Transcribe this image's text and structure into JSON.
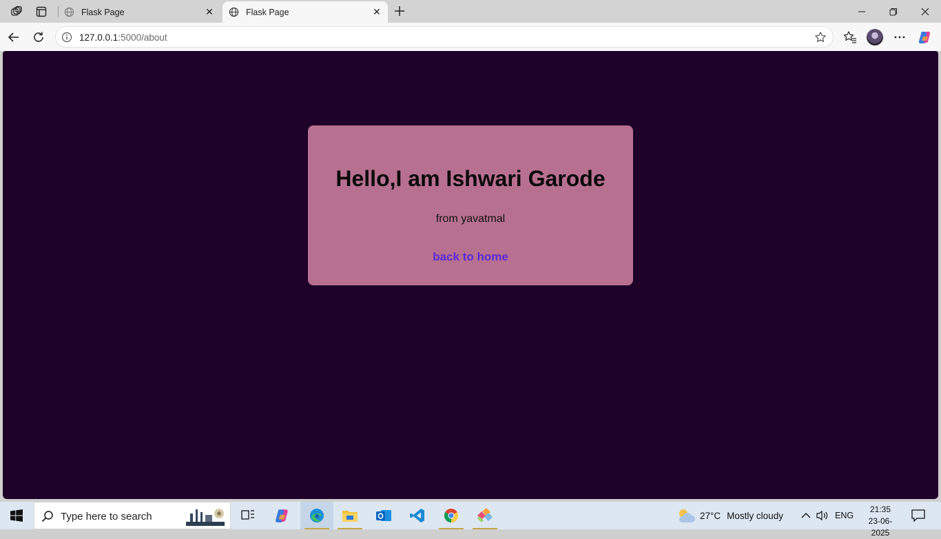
{
  "browser": {
    "tabs": [
      {
        "label": "Flask Page",
        "active": false
      },
      {
        "label": "Flask Page",
        "active": true
      }
    ],
    "url_host": "127.0.0.1",
    "url_path": ":5000/about"
  },
  "page": {
    "background": "#1e0229",
    "card_color": "#b87090",
    "heading": "Hello,I am Ishwari Garode",
    "subtitle": "from yavatmal",
    "link_text": "back to home",
    "link_color": "#5a2ad6"
  },
  "taskbar": {
    "search_placeholder": "Type here to search",
    "apps": [
      "task-view-icon",
      "copilot-icon",
      "edge-icon",
      "file-explorer-icon",
      "outlook-icon",
      "vscode-icon",
      "chrome-icon",
      "git-icon"
    ],
    "weather_temp": "27°C",
    "weather_text": "Mostly cloudy",
    "language": "ENG",
    "time": "21:35",
    "date": "23-06-2025"
  }
}
